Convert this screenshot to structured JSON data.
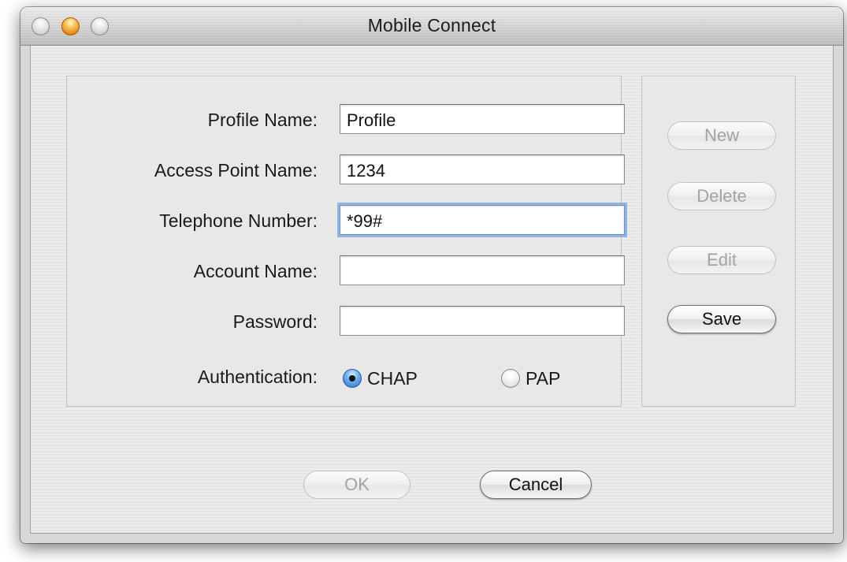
{
  "window": {
    "title": "Mobile Connect"
  },
  "form": {
    "profile_name": {
      "label": "Profile Name:",
      "value": "Profile"
    },
    "access_point": {
      "label": "Access Point Name:",
      "value": "1234"
    },
    "telephone": {
      "label": "Telephone Number:",
      "value": "*99#"
    },
    "account_name": {
      "label": "Account Name:",
      "value": ""
    },
    "password": {
      "label": "Password:",
      "value": ""
    },
    "authentication": {
      "label": "Authentication:",
      "options": [
        "CHAP",
        "PAP"
      ],
      "selected": "CHAP"
    }
  },
  "side_buttons": {
    "new": "New",
    "delete": "Delete",
    "edit": "Edit",
    "save": "Save"
  },
  "dialog_buttons": {
    "ok": "OK",
    "cancel": "Cancel"
  },
  "icons": {
    "close": "close-button-icon",
    "minimize": "minimize-button-icon",
    "zoom": "zoom-button-icon",
    "radio_checked": "radio-checked-icon",
    "radio_unchecked": "radio-unchecked-icon"
  },
  "colors": {
    "minimize_button": "#e98a12",
    "focus_ring": "#6797dc",
    "radio_selected": "#2a6fd0"
  }
}
